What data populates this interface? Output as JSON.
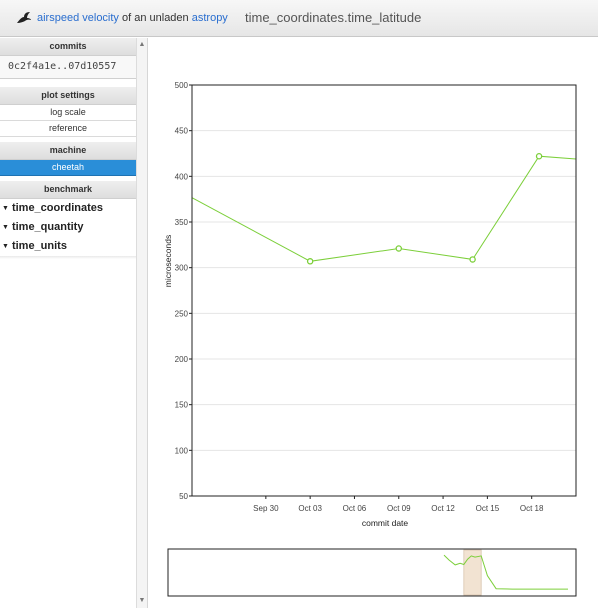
{
  "header": {
    "brand_link1": "airspeed velocity",
    "brand_mid": " of an unladen ",
    "brand_link2": "astropy",
    "benchmark_title": "time_coordinates.time_latitude"
  },
  "sidebar": {
    "commits": {
      "title": "commits",
      "range": "0c2f4a1e..07d10557"
    },
    "plot_settings": {
      "title": "plot settings",
      "options": [
        "log scale",
        "reference"
      ]
    },
    "machine": {
      "title": "machine",
      "options": [
        "cheetah"
      ],
      "selected": "cheetah"
    },
    "benchmark": {
      "title": "benchmark",
      "items": [
        "time_coordinates",
        "time_quantity",
        "time_units"
      ]
    }
  },
  "colors": {
    "series": "#7ccf3a",
    "selected_machine": "#2a8ed8",
    "brush": "#f2e3d2"
  },
  "chart_data": {
    "type": "line",
    "title": "",
    "xlabel": "commit date",
    "ylabel": "microseconds",
    "ylim": [
      50,
      500
    ],
    "yticks": [
      50,
      100,
      150,
      200,
      250,
      300,
      350,
      400,
      450,
      500
    ],
    "xrange": [
      "2015-09-25",
      "2015-10-21"
    ],
    "xticks": [
      {
        "date": "2015-09-30",
        "label": "Sep 30"
      },
      {
        "date": "2015-10-03",
        "label": "Oct 03"
      },
      {
        "date": "2015-10-06",
        "label": "Oct 06"
      },
      {
        "date": "2015-10-09",
        "label": "Oct 09"
      },
      {
        "date": "2015-10-12",
        "label": "Oct 12"
      },
      {
        "date": "2015-10-15",
        "label": "Oct 15"
      },
      {
        "date": "2015-10-18",
        "label": "Oct 18"
      }
    ],
    "grid": true,
    "series": [
      {
        "points": [
          {
            "x": "2015-09-24 12:00",
            "y": 381,
            "marker": false
          },
          {
            "x": "2015-10-03",
            "y": 307,
            "marker": true
          },
          {
            "x": "2015-10-09",
            "y": 321,
            "marker": true
          },
          {
            "x": "2015-10-14",
            "y": 309,
            "marker": true
          },
          {
            "x": "2015-10-18 12:00",
            "y": 422,
            "marker": true
          },
          {
            "x": "2015-10-21",
            "y": 419,
            "marker": false
          }
        ]
      }
    ],
    "overview": {
      "series": [
        {
          "x": 0.0,
          "y": 0.1
        },
        {
          "x": 0.04,
          "y": 0.22
        },
        {
          "x": 0.09,
          "y": 0.34
        },
        {
          "x": 0.13,
          "y": 0.3
        },
        {
          "x": 0.16,
          "y": 0.33
        },
        {
          "x": 0.19,
          "y": 0.2
        },
        {
          "x": 0.22,
          "y": 0.12
        },
        {
          "x": 0.25,
          "y": 0.15
        },
        {
          "x": 0.3,
          "y": 0.12
        },
        {
          "x": 0.35,
          "y": 0.6
        },
        {
          "x": 0.42,
          "y": 0.92
        },
        {
          "x": 0.55,
          "y": 0.93
        },
        {
          "x": 0.7,
          "y": 0.93
        },
        {
          "x": 0.87,
          "y": 0.93
        },
        {
          "x": 1.0,
          "y": 0.93
        }
      ],
      "selection": {
        "from": 0.16,
        "to": 0.3
      }
    }
  }
}
